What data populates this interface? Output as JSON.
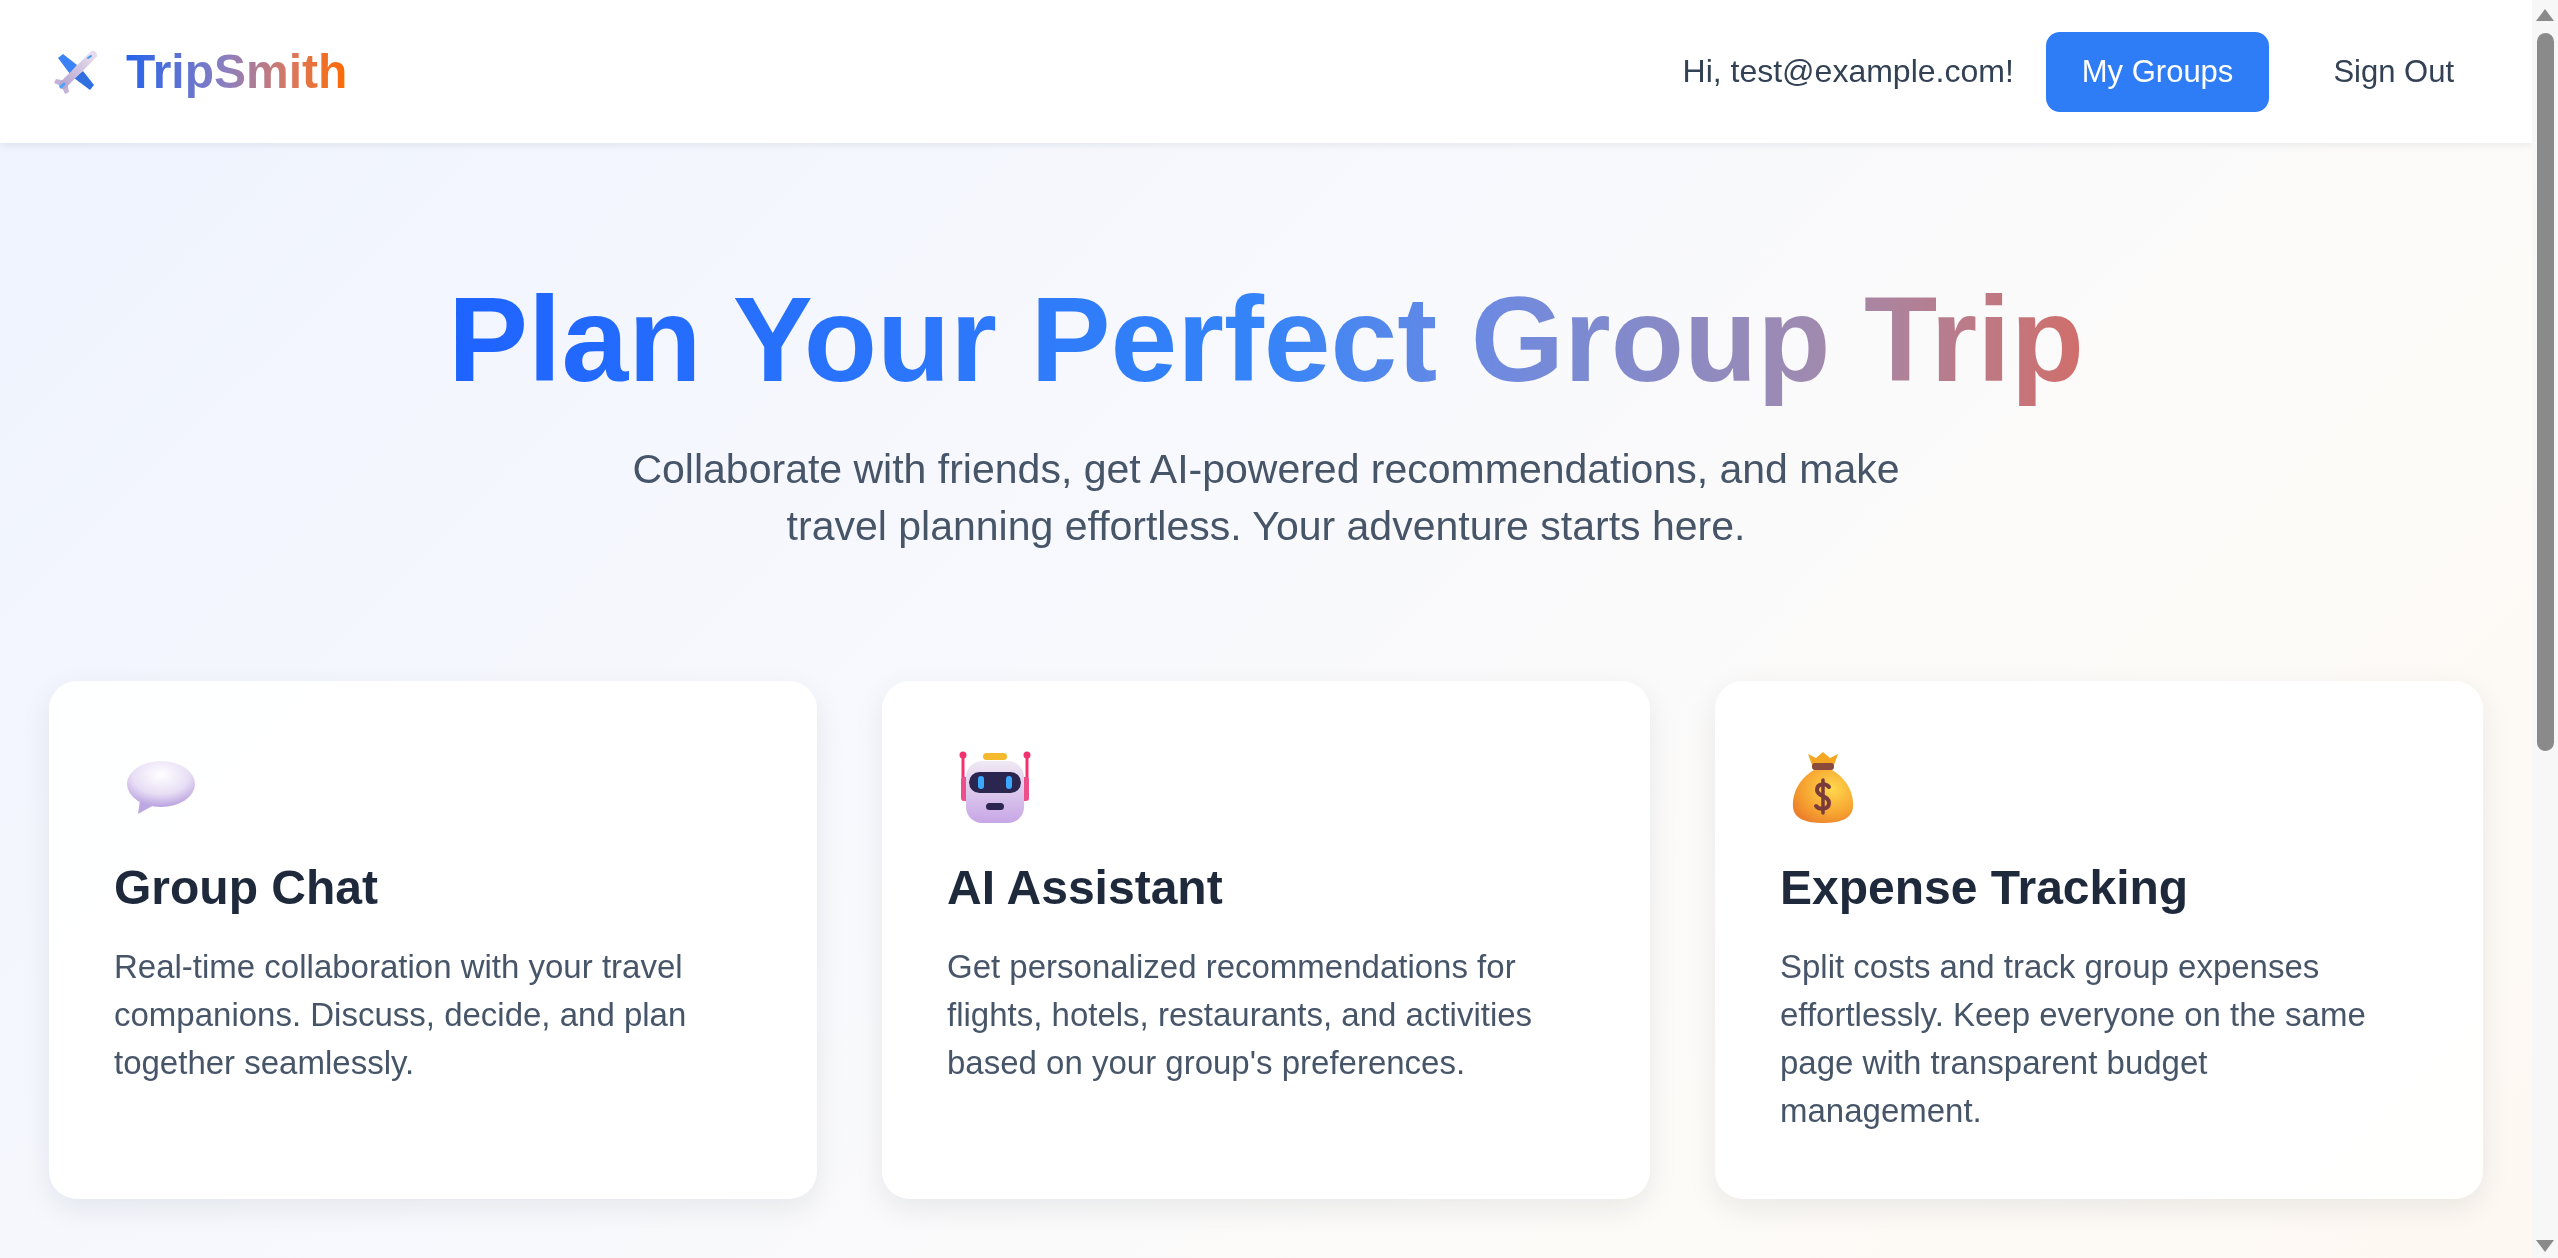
{
  "header": {
    "logo": "TripSmith",
    "greeting": "Hi, test@example.com!",
    "nav": [
      {
        "label": "My Groups",
        "kind": "primary"
      },
      {
        "label": "Sign Out",
        "kind": "plain"
      }
    ]
  },
  "hero": {
    "title": "Plan Your Perfect Group Trip",
    "subtitle": "Collaborate with friends, get AI-powered recommendations, and make travel planning effortless. Your adventure starts here."
  },
  "features": [
    {
      "title": "Group Chat",
      "text": "Real-time collaboration with your travel companions. Discuss, decide, and plan together seamlessly."
    },
    {
      "title": "AI Assistant",
      "text": "Get personalized recommendations for flights, hotels, restaurants, and activities based on your group's preferences."
    },
    {
      "title": "Expense Tracking",
      "text": "Split costs and track group expenses effortlessly. Keep everyone on the same page with transparent budget management."
    }
  ]
}
